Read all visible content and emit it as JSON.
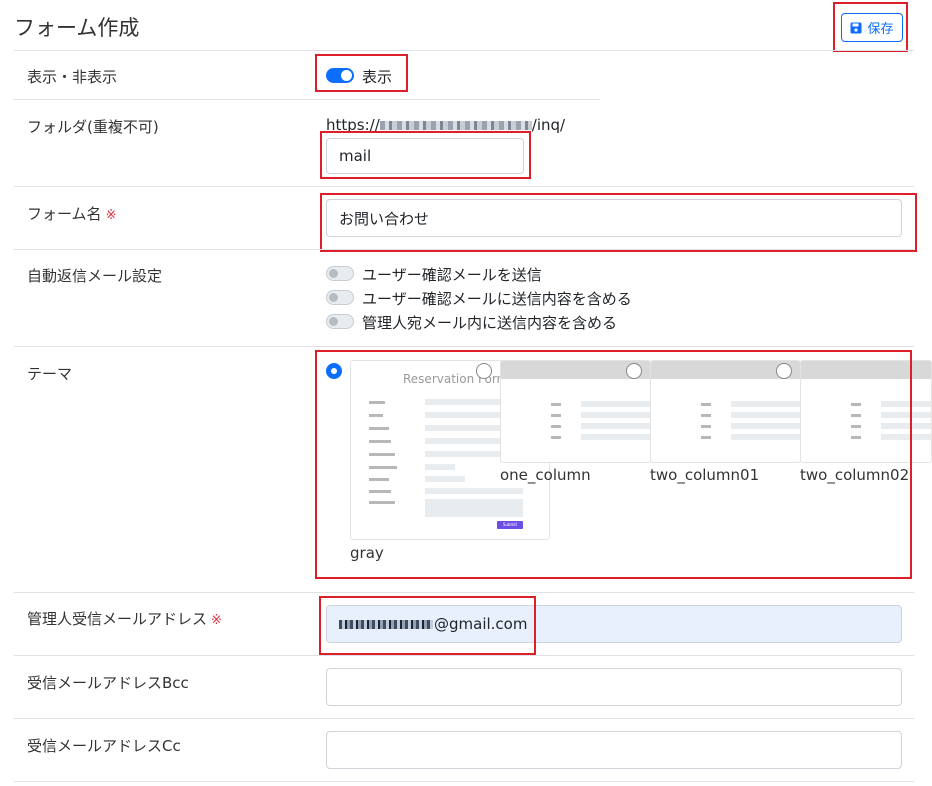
{
  "header": {
    "title": "フォーム作成",
    "save_label": "保存",
    "save_icon": "floppy-disk-icon"
  },
  "visibility": {
    "label": "表示・非表示",
    "state_label": "表示",
    "enabled": true
  },
  "folder": {
    "label": "フォルダ(重複不可)",
    "url_prefix": "https://",
    "url_suffix": "/inq/",
    "value": "mail"
  },
  "form_name": {
    "label": "フォーム名",
    "required_mark": "※",
    "value": "お問い合わせ"
  },
  "auto_reply": {
    "label": "自動返信メール設定",
    "options": [
      {
        "label": "ユーザー確認メールを送信",
        "enabled": false
      },
      {
        "label": "ユーザー確認メールに送信内容を含める",
        "enabled": false
      },
      {
        "label": "管理人宛メール内に送信内容を含める",
        "enabled": false
      }
    ]
  },
  "theme": {
    "label": "テーマ",
    "selected": "gray",
    "options": [
      {
        "name": "gray",
        "preview_title": "Reservation Form",
        "submit_label": "Submit"
      },
      {
        "name": "one_column"
      },
      {
        "name": "two_column01"
      },
      {
        "name": "two_column02"
      }
    ]
  },
  "admin_email": {
    "label": "管理人受信メールアドレス",
    "required_mark": "※",
    "value_suffix": "@gmail.com"
  },
  "bcc": {
    "label": "受信メールアドレスBcc",
    "value": ""
  },
  "cc": {
    "label": "受信メールアドレスCc",
    "value": ""
  },
  "colors": {
    "primary": "#0d6efd",
    "highlight": "#dd1f2b",
    "required": "#dc3545",
    "autofill": "#e8f0fe"
  }
}
